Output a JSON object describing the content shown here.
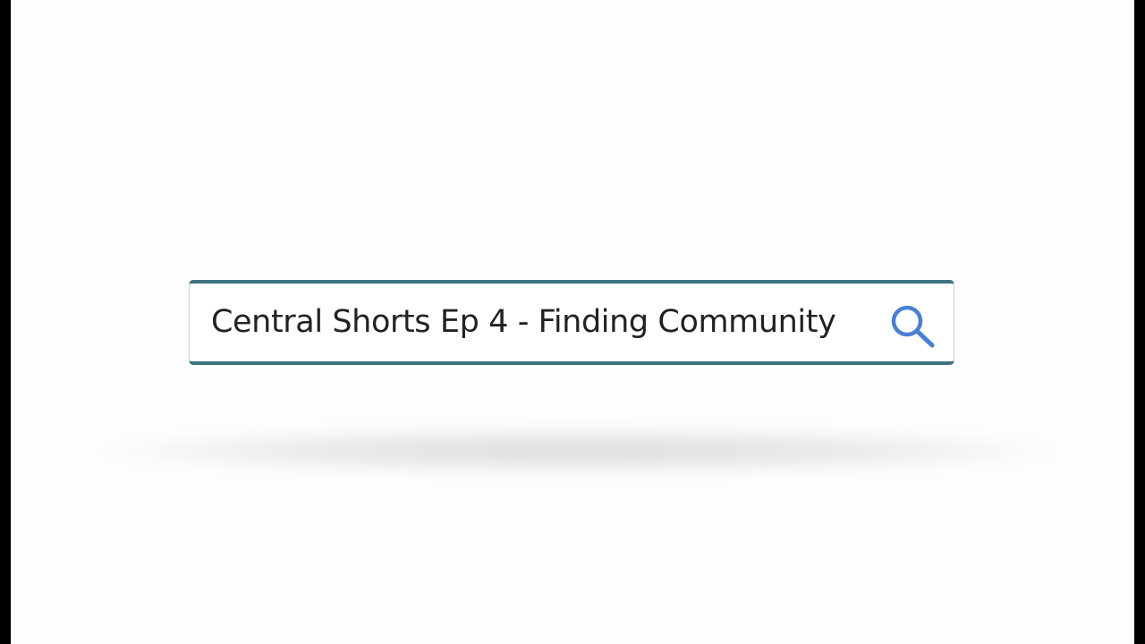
{
  "search": {
    "query": "Central Shorts Ep 4 - Finding Community",
    "icon": "search-icon"
  },
  "colors": {
    "border_accent": "#3d7480",
    "icon": "#4a7fd6",
    "background": "#fdfdfd",
    "letterbox": "#000000"
  }
}
